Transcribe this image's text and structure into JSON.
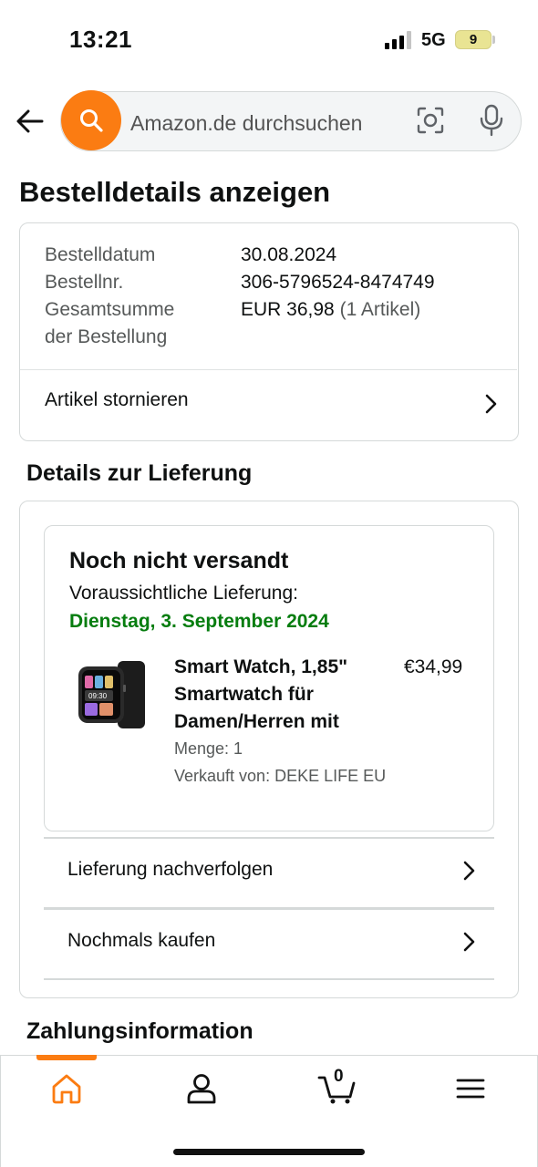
{
  "status_bar": {
    "time": "13:21",
    "network": "5G",
    "battery": "9"
  },
  "search": {
    "placeholder": "Amazon.de durchsuchen"
  },
  "page_title": "Bestelldetails anzeigen",
  "order": {
    "date_label": "Bestelldatum",
    "date_value": "30.08.2024",
    "number_label": "Bestellnr.",
    "number_value": "306-5796524-8474749",
    "total_label_1": "Gesamtsumme",
    "total_label_2": "der Bestellung",
    "total_value": "EUR 36,98",
    "total_items": "(1 Artikel)",
    "cancel_label": "Artikel stornieren"
  },
  "delivery": {
    "section_title": "Details zur Lieferung",
    "status": "Noch nicht versandt",
    "expected_label": "Voraussichtliche Lieferung:",
    "expected_date": "Dienstag, 3. September 2024",
    "product": {
      "title_line1": "Smart Watch, 1,85\"",
      "title_line2": "Smartwatch für",
      "title_line3": "Damen/Herren mit",
      "price": "€34,99",
      "quantity": "Menge: 1",
      "seller": "Verkauft von: DEKE LIFE EU",
      "image_text": "09:30"
    },
    "track_label": "Lieferung nachverfolgen",
    "buy_again_label": "Nochmals kaufen"
  },
  "payment": {
    "section_title": "Zahlungsinformation"
  },
  "bottom_nav": {
    "cart_count": "0"
  },
  "colors": {
    "accent": "#fb7c12",
    "delivery_green": "#067d0f",
    "border": "#d5d9d9"
  },
  "icons": [
    "back-arrow-icon",
    "search-icon",
    "camera-icon",
    "mic-icon",
    "chevron-right-icon",
    "home-icon",
    "account-icon",
    "cart-icon",
    "menu-icon"
  ]
}
